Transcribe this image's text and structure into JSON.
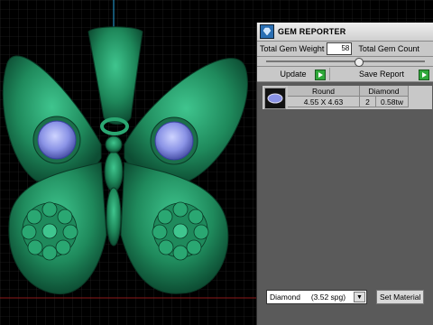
{
  "panel": {
    "title": "GEM REPORTER",
    "total_weight_label": "Total Gem Weight",
    "total_weight_value": "58",
    "total_count_label": "Total Gem Count",
    "update_label": "Update",
    "save_report_label": "Save Report",
    "gem": {
      "shape": "Round",
      "material": "Diamond",
      "size": "4.55 X 4.63",
      "count": "2",
      "weight": "0.58tw"
    },
    "material_select": "Diamond     (3.52 spg)",
    "set_material_label": "Set Material"
  },
  "colors": {
    "metal": "#1f8a5c",
    "gem": "#8a93e6",
    "panel_bg": "#5a5a5a",
    "play_green": "#2fa83a"
  },
  "icons": {
    "app": "gem-reporter-icon",
    "play": "play-icon",
    "dropdown": "chevron-down-icon",
    "gem_thumb": "round-gem-icon"
  }
}
